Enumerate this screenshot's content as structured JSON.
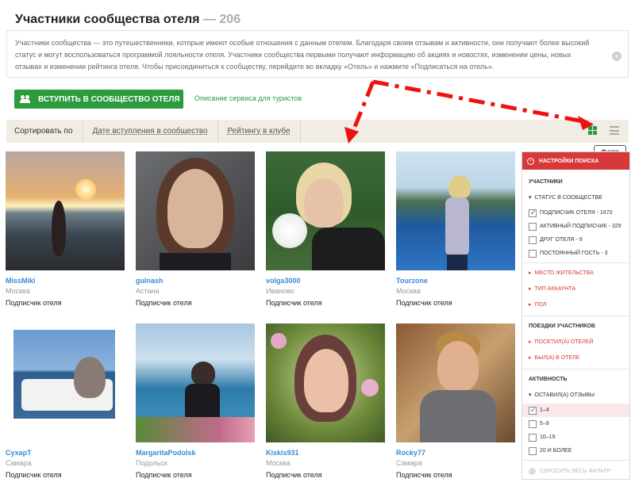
{
  "header": {
    "title": "Участники сообщества отеля",
    "separator": " — ",
    "count": "206"
  },
  "info": {
    "text": "Участники сообщества — это путешественники, которые имеют особые отношения с данным отелем. Благодаря своим отзывам и активности, они получают более высокий статус и могут воспользоваться программой лояльности отеля. Участники сообщества первыми получают информацию об акциях и новостях, изменении цены, новых отзывах и изменении рейтинга отеля. Чтобы присоединиться к сообществу, перейдите во вкладку «Отель» и нажмите «Подписаться на отель».",
    "close_icon": "×"
  },
  "actions": {
    "join_label": "ВСТУПИТЬ В СООБЩЕСТВО ОТЕЛЯ",
    "service_link": "Описание сервиса для туристов"
  },
  "sort": {
    "label": "Сортировать по",
    "options": [
      "Дате вступления в сообщество",
      "Рейтингу в клубе"
    ]
  },
  "view": {
    "tooltip": "Фото",
    "active": "grid"
  },
  "members": [
    {
      "name": "MissMiki",
      "city": "Москва",
      "role": "Подписчик отеля"
    },
    {
      "name": "gulnash",
      "city": "Астана",
      "role": "Подписчик отеля"
    },
    {
      "name": "volga3000",
      "city": "Иваново",
      "role": "Подписчик отеля"
    },
    {
      "name": "Tourzone",
      "city": "Москва",
      "role": "Подписчик отеля"
    },
    {
      "name": "СухарТ",
      "city": "Самара",
      "role": "Подписчик отеля"
    },
    {
      "name": "MargaritaPodolsk",
      "city": "Подольск",
      "role": "Подписчик отеля"
    },
    {
      "name": "Kiskis931",
      "city": "Москва",
      "role": "Подписчик отеля"
    },
    {
      "name": "Rocky77",
      "city": "Самара",
      "role": "Подписчик отеля"
    }
  ],
  "filters": {
    "header": "НАСТРОЙКИ ПОИСКА",
    "participants_title": "УЧАСТНИКИ",
    "status_title": "СТАТУС В СООБЩЕСТВЕ",
    "status_options": [
      {
        "label": "ПОДПИСЧИК ОТЕЛЯ - 1670",
        "checked": true
      },
      {
        "label": "АКТИВНЫЙ ПОДПИСЧИК - 329",
        "checked": false
      },
      {
        "label": "ДРУГ ОТЕЛЯ - 9",
        "checked": false
      },
      {
        "label": "ПОСТОЯННЫЙ ГОСТЬ - 3",
        "checked": false
      }
    ],
    "residence": "МЕСТО ЖИТЕЛЬСТВА",
    "account_type": "ТИП АККАУНТА",
    "gender": "ПОЛ",
    "trips_title": "ПОЕЗДКИ УЧАСТНИКОВ",
    "visited": "ПОСЕТИЛ(А) ОТЕЛЕЙ",
    "was_in": "БЫЛ(А) В ОТЕЛЕ",
    "activity_title": "АКТИВНОСТЬ",
    "reviews_title": "ОСТАВИЛ(А) ОТЗЫВЫ",
    "review_options": [
      {
        "label": "1–4",
        "checked": true
      },
      {
        "label": "5–9",
        "checked": false
      },
      {
        "label": "10–19",
        "checked": false
      },
      {
        "label": "20 И БОЛЕЕ",
        "checked": false
      }
    ],
    "reset": "СБРОСИТЬ ВЕСЬ ФИЛЬТР"
  },
  "colors": {
    "accent_green": "#2b9b3e",
    "accent_red": "#d7393b",
    "link_blue": "#3a8ad6"
  }
}
